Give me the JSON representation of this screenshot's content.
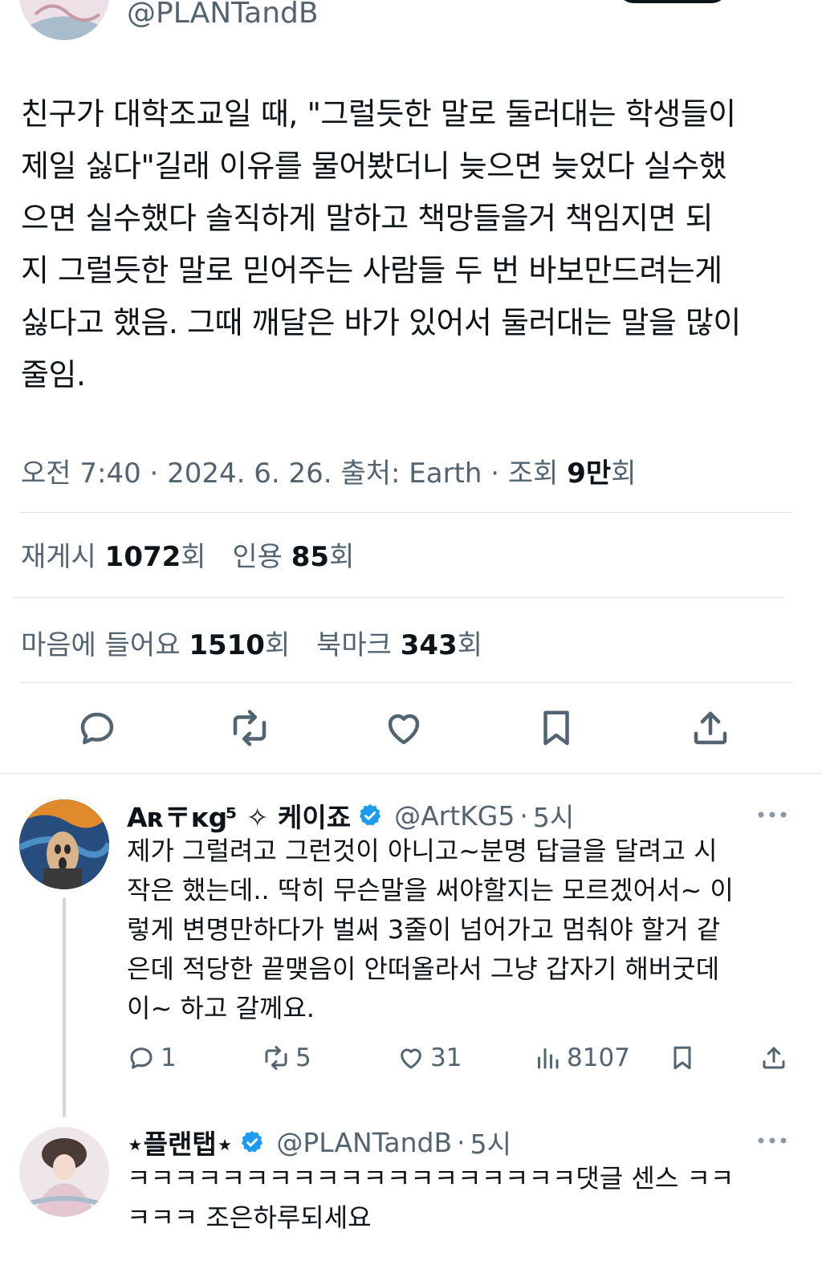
{
  "main_tweet": {
    "handle": "@PLANTandB",
    "lines": [
      "친구가 대학조교일 때, \"그럴듯한 말로 둘러대는 학생들이",
      "제일 싫다\"길래 이유를 물어봤더니 늦으면 늦었다 실수했",
      "으면 실수했다 솔직하게 말하고 책망들을거 책임지면 되",
      "지 그럴듯한 말로 믿어주는 사람들 두 번 바보만드려는게",
      "싫다고 했음. 그때 깨달은 바가 있어서 둘러대는 말을 많이",
      "줄임."
    ],
    "meta_time": "오전 7:40",
    "meta_date": "2024. 6. 26.",
    "meta_source": "출처: Earth",
    "meta_views_label": "조회",
    "meta_views_value": "9만",
    "meta_views_unit": "회",
    "dot": "·",
    "reposts_label": "재게시",
    "reposts_value": "1072",
    "quotes_label": "인용",
    "quotes_value": "85",
    "likes_label": "마음에 들어요",
    "likes_value": "1510",
    "bookmarks_label": "북마크",
    "bookmarks_value": "343",
    "unit": "회"
  },
  "replies": [
    {
      "name": "Aʀ〒ĸց⁵ ✧ 케이죠",
      "handle": "@ArtKG5",
      "time": "5시",
      "lines": [
        "제가 그럴려고 그런것이 아니고~분명 답글을 달려고 시",
        "작은 했는데.. 딱히 무슨말을 써야할지는 모르겠어서~ 이",
        "렇게 변명만하다가 벌써 3줄이 넘어가고 멈춰야 할거 같",
        "은데 적당한 끝맺음이 안떠올라서 그냥 갑자기 해버굿데",
        "이~ 하고 갈께요."
      ],
      "replies_count": "1",
      "reposts_count": "5",
      "likes_count": "31",
      "views_count": "8107"
    },
    {
      "name": "⋆플랜탭⋆",
      "handle": "@PLANTandB",
      "time": "5시",
      "lines": [
        "ㅋㅋㅋㅋㅋㅋㅋㅋㅋㅋㅋㅋㅋㅋㅋㅋㅋㅋㅋ댓글 센스 ㅋㅋ",
        "ㅋㅋㅋ 조은하루되세요"
      ]
    }
  ],
  "colors": {
    "text": "#0f1419",
    "muted": "#536471",
    "divider": "#e1e6ea",
    "verified": "#1d9bf0"
  }
}
